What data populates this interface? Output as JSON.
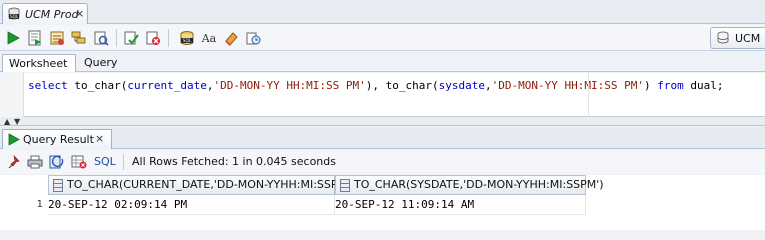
{
  "document_tab": {
    "label": "UCM Prod",
    "close": "×",
    "icon": "database-sql-icon"
  },
  "toolbar": {
    "buttons": [
      {
        "name": "run-statement-icon"
      },
      {
        "name": "run-script-icon"
      },
      {
        "name": "autotrace-icon"
      },
      {
        "name": "explain-plan-icon"
      },
      {
        "name": "sql-tuning-icon"
      },
      {
        "name": "commit-icon"
      },
      {
        "name": "rollback-icon"
      },
      {
        "name": "unshared-sql-icon"
      },
      {
        "name": "to-upper-case-icon"
      },
      {
        "name": "clear-eraser-icon"
      },
      {
        "name": "sql-history-icon"
      }
    ],
    "connection_label": "UCM"
  },
  "subtabs": {
    "worksheet": "Worksheet",
    "query_builder": "Query Builder"
  },
  "editor": {
    "tokens": [
      {
        "text": "select",
        "kind": "kw"
      },
      {
        "text": " to_char(",
        "kind": "fn"
      },
      {
        "text": "current_date",
        "kind": "kw"
      },
      {
        "text": ",",
        "kind": "fn"
      },
      {
        "text": "'DD-MON-YY HH:MI:SS PM'",
        "kind": "str"
      },
      {
        "text": "), to_char(",
        "kind": "fn"
      },
      {
        "text": "sysdate",
        "kind": "kw"
      },
      {
        "text": ",",
        "kind": "fn"
      },
      {
        "text": "'DD-MON-YY HH:MI:SS PM'",
        "kind": "str"
      },
      {
        "text": ") ",
        "kind": "fn"
      },
      {
        "text": "from",
        "kind": "kw"
      },
      {
        "text": " dual;",
        "kind": "fn"
      }
    ]
  },
  "results": {
    "tab_label": "Query Result",
    "tab_close": "×",
    "sql_link": "SQL",
    "status": "All Rows Fetched: 1 in 0.045 seconds",
    "columns": [
      "TO_CHAR(CURRENT_DATE,'DD-MON-YYHH:MI:SSPM')",
      "TO_CHAR(SYSDATE,'DD-MON-YYHH:MI:SSPM')"
    ],
    "rows": [
      {
        "num": "1",
        "cells": [
          "20-SEP-12 02:09:14 PM",
          "20-SEP-12 11:09:14 AM"
        ]
      }
    ]
  },
  "colors": {
    "keyword": "#0000c8",
    "string": "#8a1b0a",
    "link": "#1f4fa3"
  }
}
